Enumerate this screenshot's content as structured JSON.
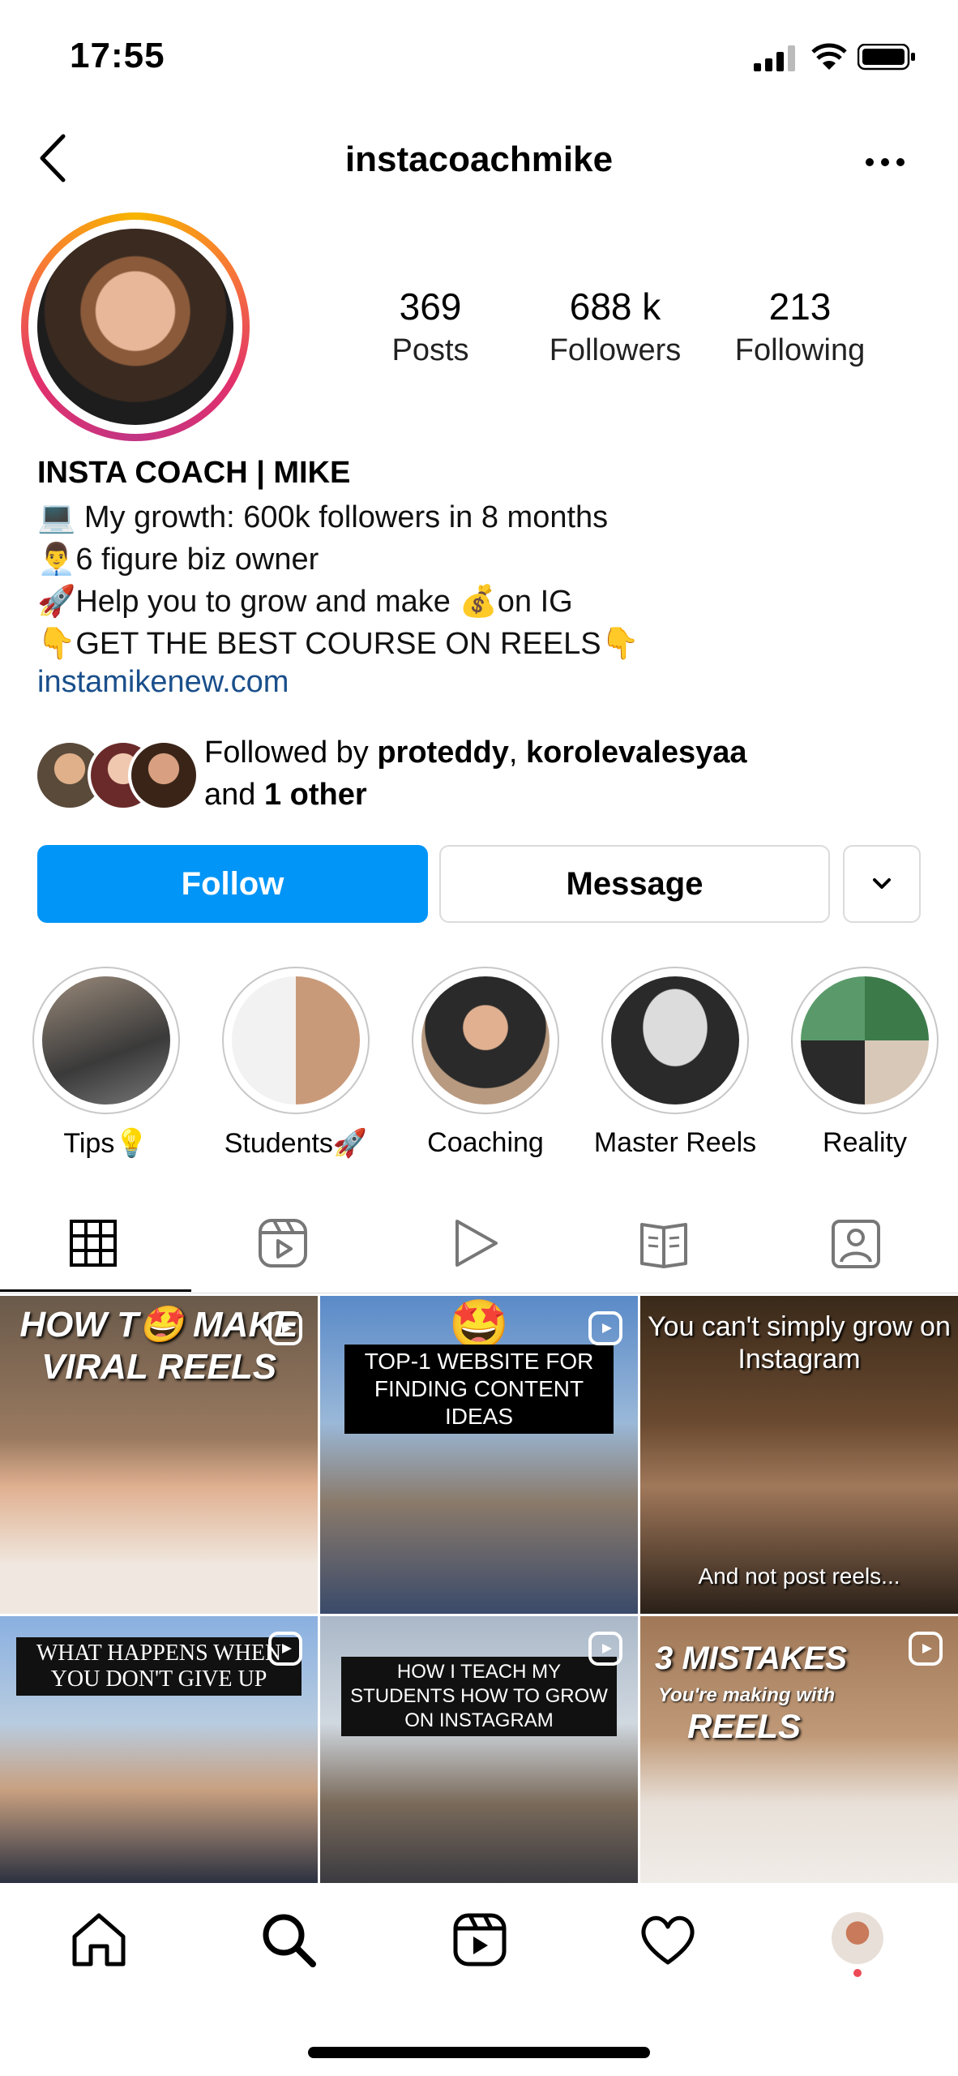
{
  "status_bar": {
    "time": "17:55"
  },
  "header": {
    "username": "instacoachmike"
  },
  "stats": [
    {
      "value": "369",
      "label": "Posts"
    },
    {
      "value": "688 k",
      "label": "Followers"
    },
    {
      "value": "213",
      "label": "Following"
    }
  ],
  "bio": {
    "name": "INSTA COACH | MIKE",
    "lines": [
      "💻 My growth: 600k followers in 8 months",
      "👨‍💼6 figure biz owner",
      "🚀Help you to grow and make 💰on IG",
      "👇GET THE BEST COURSE ON REELS👇"
    ],
    "link": "instamikenew.com"
  },
  "followed_by": {
    "prefix": "Followed by ",
    "user1": "proteddy",
    "sep": ", ",
    "user2": "korolevalesyaa",
    "and": "and ",
    "other": "1 other"
  },
  "actions": {
    "follow": "Follow",
    "message": "Message"
  },
  "highlights": [
    {
      "label": "Tips💡"
    },
    {
      "label": "Students🚀"
    },
    {
      "label": "Coaching"
    },
    {
      "label": "Master Reels"
    },
    {
      "label": "Reality"
    }
  ],
  "tabs": [
    "grid-icon",
    "reels-icon",
    "play-icon",
    "guide-icon",
    "tagged-icon"
  ],
  "posts": [
    {
      "caption": "HOW T🤩 MAKE VIRAL REELS"
    },
    {
      "emoji": "🤩",
      "caption": "TOP-1 WEBSITE FOR FINDING CONTENT IDEAS"
    },
    {
      "caption_top": "You can't simply grow on Instagram",
      "caption_bottom": "And not post reels..."
    },
    {
      "caption": "WHAT HAPPENS WHEN YOU DON'T GIVE UP"
    },
    {
      "caption": "HOW I TEACH MY STUDENTS HOW TO GROW ON INSTAGRAM"
    },
    {
      "caption_top": "3 MISTAKES",
      "caption_mid": "You're making with",
      "caption_bottom": "REELS"
    }
  ],
  "nav": [
    "home-icon",
    "search-icon",
    "reels-icon",
    "heart-icon",
    "profile-icon"
  ],
  "colors": {
    "accent": "#0095f6",
    "link": "#1a4f8b",
    "border": "#dbdbdb"
  }
}
